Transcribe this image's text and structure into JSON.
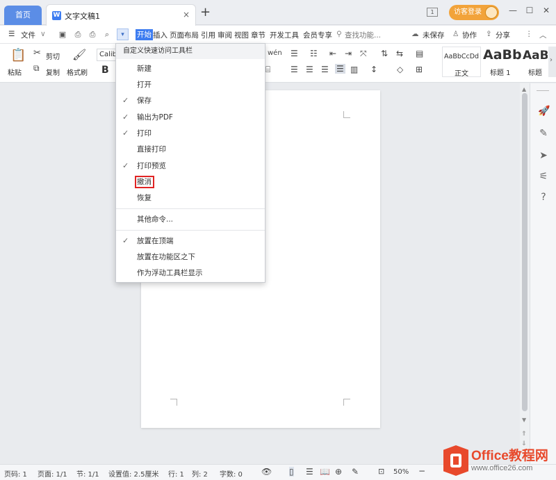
{
  "titlebar": {
    "home_tab": "首页",
    "doc_tab": "文字文稿1",
    "close": "×",
    "new_tab": "+",
    "page_badge": "1",
    "login": "访客登录",
    "min": "—",
    "max": "☐",
    "close_win": "✕"
  },
  "menubar": {
    "file": "文件",
    "menus": [
      "开始",
      "插入",
      "页面布局",
      "引用",
      "审阅",
      "视图",
      "章节",
      "开发工具",
      "会员专享"
    ],
    "search": "查找功能...",
    "unsaved": "未保存",
    "collab": "协作",
    "share": "分享"
  },
  "ribbon": {
    "paste": "粘贴",
    "cut": "剪切",
    "copy": "复制",
    "format_painter": "格式刷",
    "font_name": "Calib",
    "bold": "B",
    "style_sample_normal": "AaBbCcDd",
    "style_sample_h1": "AaBb",
    "style_sample_h2": "AaB",
    "style_normal": "正文",
    "style_h1": "标题 1",
    "style_h2": "标题"
  },
  "dropdown": {
    "header": "自定义快速访问工具栏",
    "items": [
      {
        "label": "新建",
        "checked": false
      },
      {
        "label": "打开",
        "checked": false
      },
      {
        "label": "保存",
        "checked": true
      },
      {
        "label": "输出为PDF",
        "checked": true
      },
      {
        "label": "打印",
        "checked": true
      },
      {
        "label": "直接打印",
        "checked": false
      },
      {
        "label": "打印预览",
        "checked": true
      },
      {
        "label": "撤消",
        "checked": false
      },
      {
        "label": "恢复",
        "checked": false
      }
    ],
    "other": "其他命令...",
    "position_items": [
      {
        "label": "放置在顶端",
        "checked": true
      },
      {
        "label": "放置在功能区之下",
        "checked": false
      },
      {
        "label": "作为浮动工具栏显示",
        "checked": false
      }
    ],
    "check_mark": "✓"
  },
  "statusbar": {
    "page_num": "页码: 1",
    "pages": "页面: 1/1",
    "section": "节: 1/1",
    "setting": "设置值: 2.5厘米",
    "row": "行: 1",
    "col": "列: 2",
    "words": "字数: 0",
    "zoom": "50%"
  },
  "watermark": {
    "brand": "Office教程网",
    "url": "www.office26.com"
  },
  "colors": {
    "accent": "#3d7cf0",
    "home_tab": "#5b8de6",
    "login": "#f2a33a",
    "highlight": "#e02424",
    "watermark": "#e8492c"
  }
}
